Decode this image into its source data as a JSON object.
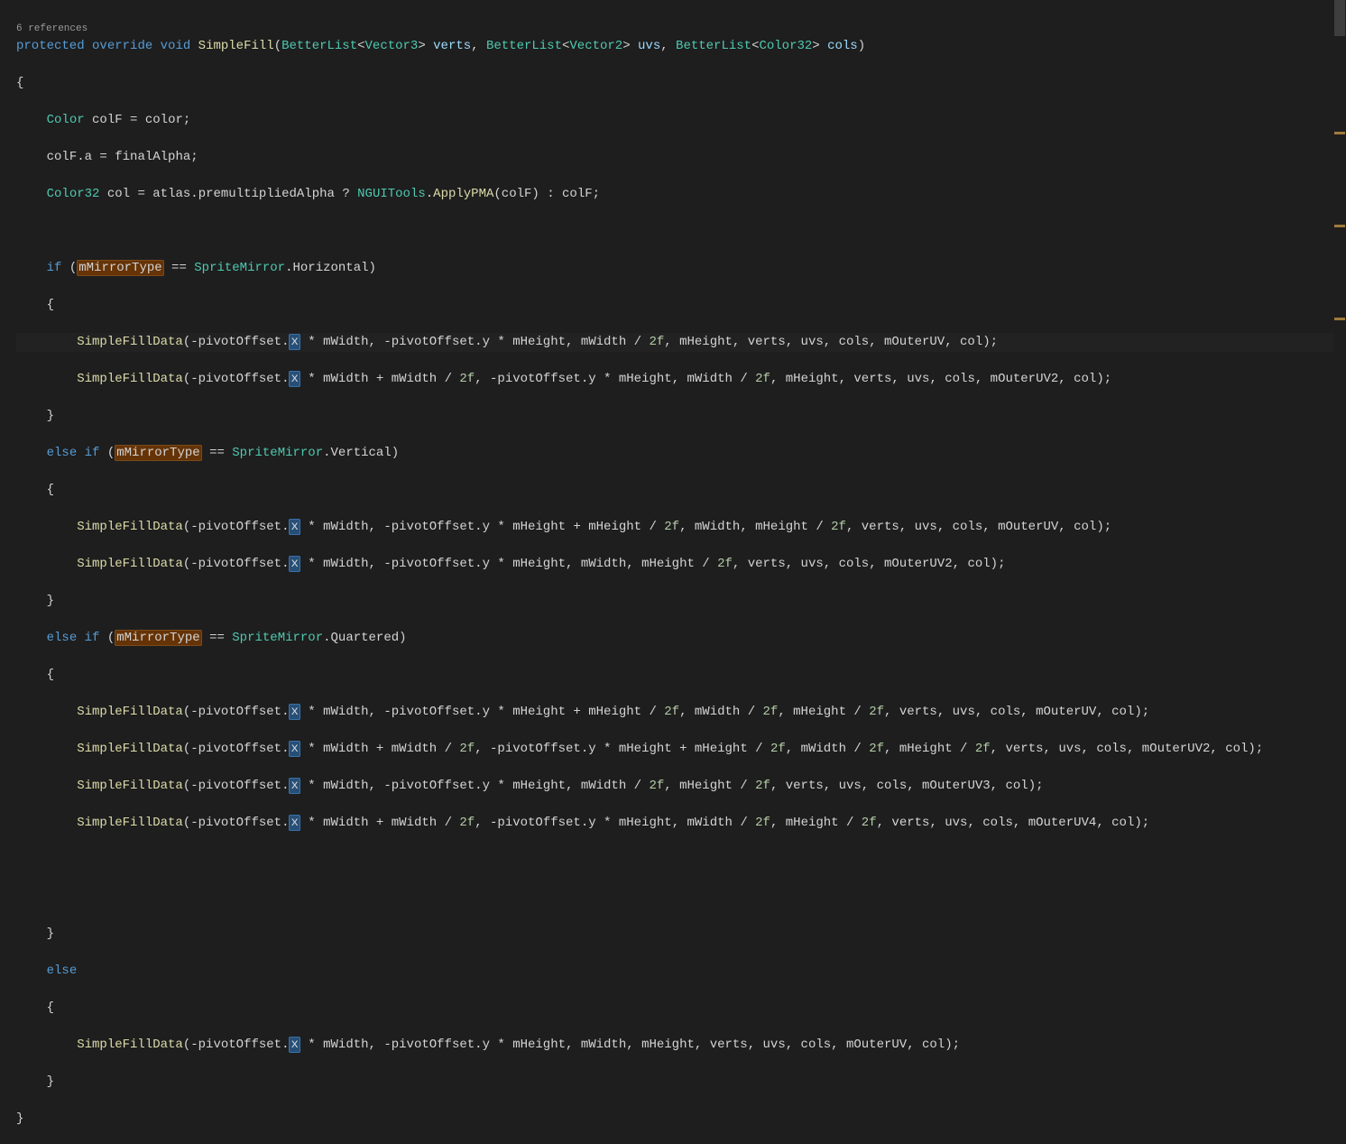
{
  "codelens": "6 references",
  "tokens": {
    "kw_protected": "protected",
    "kw_override": "override",
    "kw_void": "void",
    "kw_if": "if",
    "kw_else": "else",
    "fn_simplefill": "SimpleFill",
    "fn_simplefilldata": "SimpleFillData",
    "fn_applypma": "ApplyPMA",
    "t_betterlist": "BetterList",
    "t_vector3": "Vector3",
    "t_vector2": "Vector2",
    "t_color32": "Color32",
    "t_color": "Color",
    "t_spritemirror": "SpriteMirror",
    "t_nguitools": "NGUITools",
    "p_verts": "verts",
    "p_uvs": "uvs",
    "p_cols": "cols",
    "v_colf": "colF",
    "v_col": "col",
    "f_color": "color",
    "f_a": "a",
    "f_finalalpha": "finalAlpha",
    "f_atlas": "atlas",
    "f_premultipliedalpha": "premultipliedAlpha",
    "f_mmirrortype": "mMirrorType",
    "f_horizontal": "Horizontal",
    "f_vertical": "Vertical",
    "f_quartered": "Quartered",
    "f_pivotoffset": "pivotOffset",
    "f_x": "x",
    "f_y": "y",
    "f_mwidth": "mWidth",
    "f_mheight": "mHeight",
    "f_mouteruv": "mOuterUV",
    "f_mouteruv2": "mOuterUV2",
    "f_mouteruv3": "mOuterUV3",
    "f_mouteruv4": "mOuterUV4",
    "lit_2f": "2f",
    "brace_open": "{",
    "brace_close": "}",
    "paren_open": "(",
    "paren_close": ")",
    "angle_open": "<",
    "angle_close": ">",
    "semicolon": ";",
    "comma": ", ",
    "dot": ".",
    "eq": " = ",
    "eqeq": " == ",
    "minus": "-",
    "plus": " + ",
    "star": " * ",
    "slash": " / ",
    "qmark": " ? ",
    "colon": " : "
  }
}
